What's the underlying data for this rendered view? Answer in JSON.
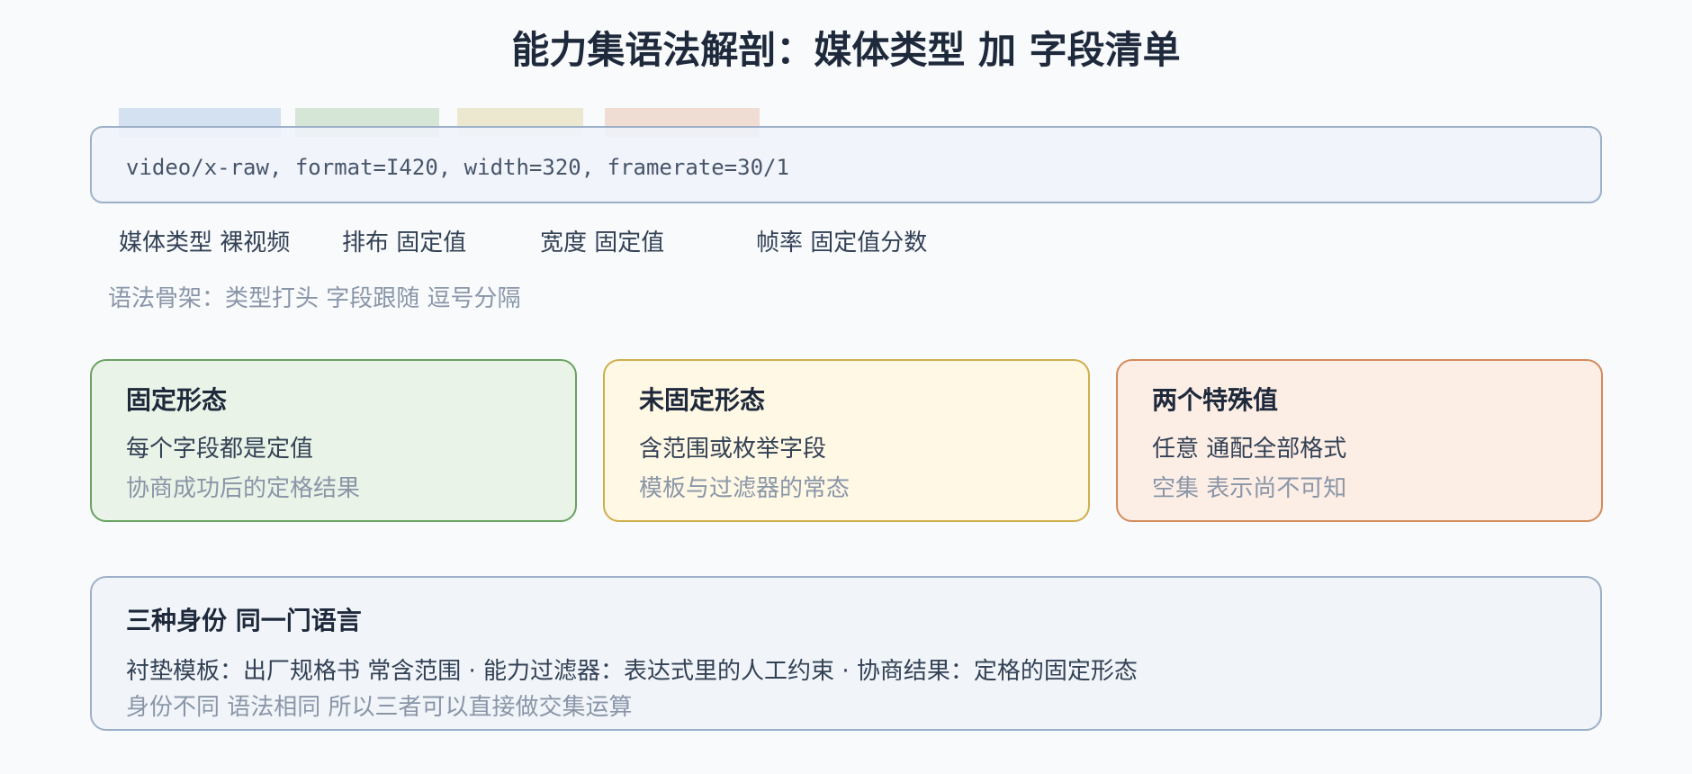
{
  "title": "能力集语法解剖：媒体类型 加 字段清单",
  "colors": {
    "swatch_media_type": "#d3e1f1",
    "swatch_format": "#d6e6d6",
    "swatch_width": "#ece8d0",
    "swatch_framerate": "#efdcd2",
    "card_fixed_bg": "#e9f3e7",
    "card_fixed_border": "#6aa262",
    "card_unfixed_bg": "#fef8e5",
    "card_unfixed_border": "#cfae4c",
    "card_special_bg": "#fdeee5",
    "card_special_border": "#d38a5c"
  },
  "code": {
    "expression": "video/x-raw, format=I420, width=320, framerate=30/1"
  },
  "segments": [
    {
      "label": "媒体类型 裸视频"
    },
    {
      "label": "排布 固定值"
    },
    {
      "label": "宽度 固定值"
    },
    {
      "label": "帧率 固定值分数"
    }
  ],
  "skeleton": "语法骨架：类型打头 字段跟随 逗号分隔",
  "cards": [
    {
      "title": "固定形态",
      "line1": "每个字段都是定值",
      "line2": "协商成功后的定格结果"
    },
    {
      "title": "未固定形态",
      "line1": "含范围或枚举字段",
      "line2": "模板与过滤器的常态"
    },
    {
      "title": "两个特殊值",
      "line1": "任意 通配全部格式",
      "line2": "空集 表示尚不可知"
    }
  ],
  "summary": {
    "title": "三种身份 同一门语言",
    "line1": "衬垫模板：出厂规格书 常含范围 · 能力过滤器：表达式里的人工约束 · 协商结果：定格的固定形态",
    "line2": "身份不同 语法相同 所以三者可以直接做交集运算"
  }
}
